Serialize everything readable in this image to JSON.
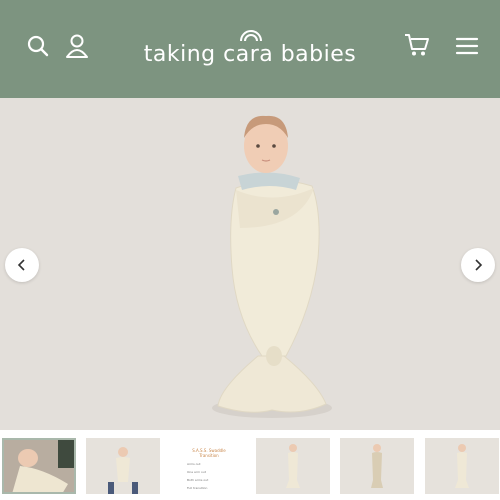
{
  "header": {
    "brand": "taking cara babies",
    "background": "#7d9480",
    "icons": [
      "search-icon",
      "account-icon",
      "cart-icon",
      "menu-icon"
    ]
  },
  "carousel": {
    "prev_icon": "chevron-left-icon",
    "next_icon": "chevron-right-icon",
    "slide_image": "swaddled baby in cream swaddle sack"
  },
  "thumbnails": {
    "count": 6,
    "active_index": 0,
    "list_card": {
      "title": "S.A.S.S. Swaddle Transition",
      "rows": [
        "Arms out",
        "One arm out",
        "Both arms out",
        "Full transition"
      ]
    }
  }
}
